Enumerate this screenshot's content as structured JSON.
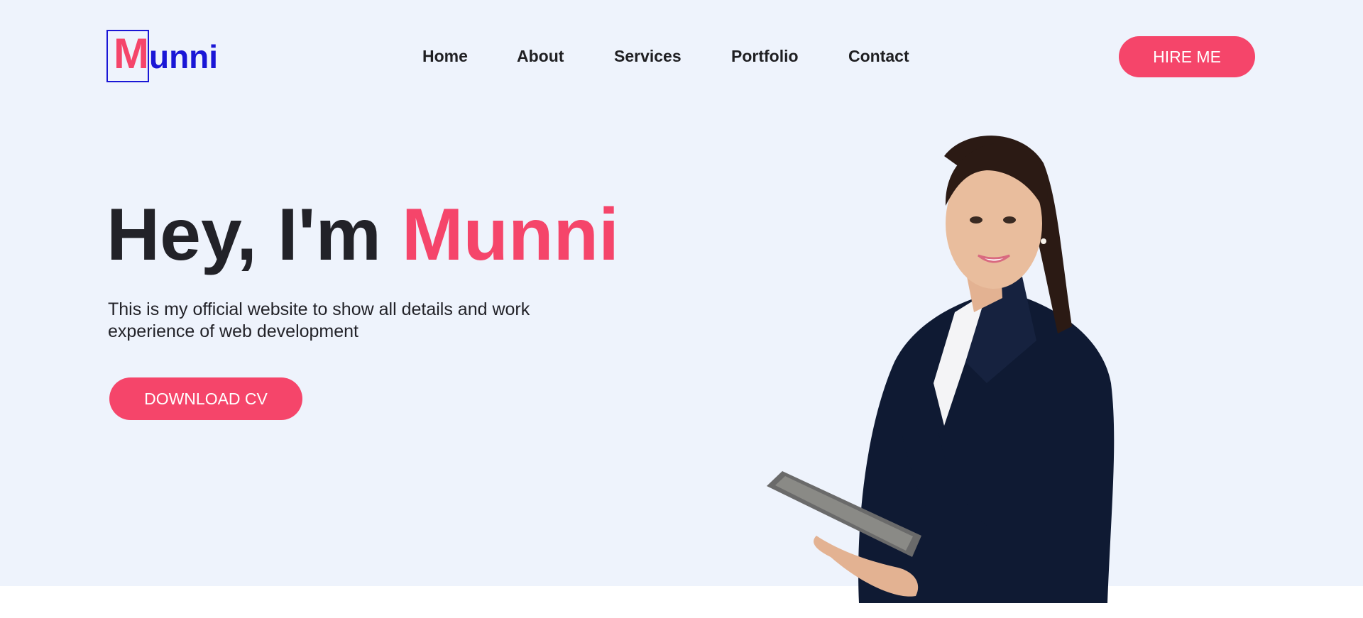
{
  "header": {
    "logo": {
      "initial": "M",
      "rest": "unni"
    },
    "nav": [
      {
        "label": "Home"
      },
      {
        "label": "About"
      },
      {
        "label": "Services"
      },
      {
        "label": "Portfolio"
      },
      {
        "label": "Contact"
      }
    ],
    "hire_label": "HIRE ME"
  },
  "hero": {
    "greeting": "Hey, I'm ",
    "name": "Munni",
    "subtitle": "This is my official website to show all details and work experience of web development",
    "cv_label": "DOWNLOAD CV"
  },
  "colors": {
    "accent": "#f5456a",
    "logo_blue": "#1a16d6",
    "hero_background": "#eef3fc",
    "text_dark": "#222228"
  },
  "icons": {
    "portrait": "woman-with-tablet-photo"
  }
}
